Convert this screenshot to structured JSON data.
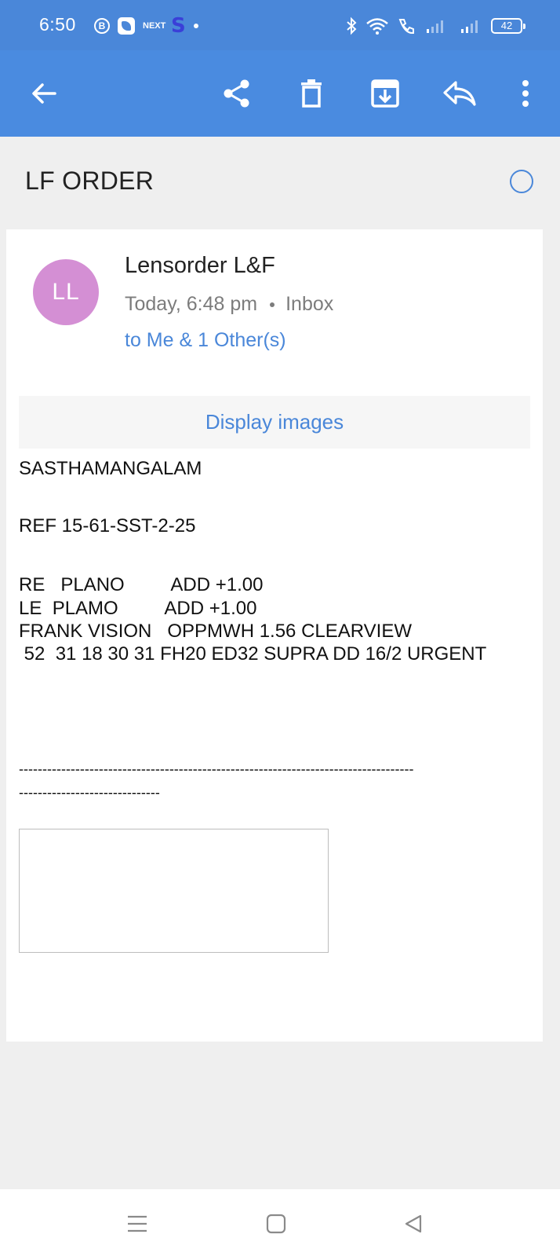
{
  "status_bar": {
    "time": "6:50",
    "left_icons": [
      "b-circle-icon",
      "app-icon",
      "news-icon",
      "s-icon",
      "dot-icon"
    ],
    "next_label": "NEXT",
    "s_label": "S",
    "b_label": "B",
    "battery": "42"
  },
  "toolbar": {
    "icons": [
      "back-arrow-icon",
      "share-icon",
      "delete-icon",
      "archive-icon",
      "reply-icon",
      "more-vert-icon"
    ]
  },
  "email": {
    "subject": "LF ORDER",
    "sender_initials": "LL",
    "sender_name": "Lensorder L&F",
    "time": "Today, 6:48 pm",
    "folder": "Inbox",
    "recipients": "to Me & 1 Other(s)",
    "display_images": "Display images",
    "body": {
      "line1": "SASTHAMANGALAM",
      "line2": "REF 15-61-SST-2-25",
      "line3": "RE   PLANO         ADD +1.00",
      "line4": "LE  PLAMO         ADD +1.00",
      "line5": "FRANK VISION   OPPMWH 1.56 CLEARVIEW",
      "line6": " 52  31 18 30 31 FH20 ED32 SUPRA DD 16/2 URGENT",
      "divider1": "------------------------------------------------------------------------------------",
      "divider2": "------------------------------"
    }
  },
  "nav_bar": {
    "icons": [
      "menu-icon",
      "home-icon",
      "back-triangle-icon"
    ]
  },
  "colors": {
    "accent": "#4a87d9",
    "avatar": "#d48fd4",
    "background": "#efefef"
  }
}
